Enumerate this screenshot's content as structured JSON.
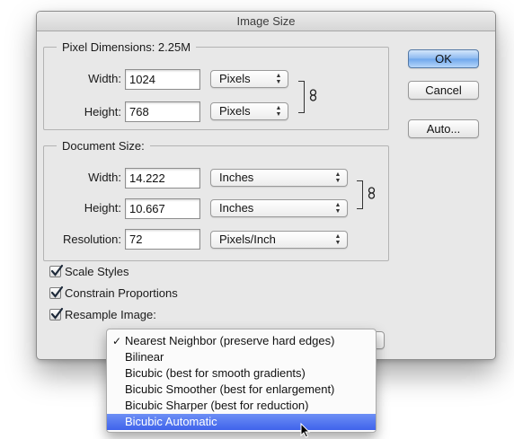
{
  "window": {
    "title": "Image Size"
  },
  "pixel_dimensions": {
    "legend": "Pixel Dimensions:  2.25M",
    "width_label": "Width:",
    "width_value": "1024",
    "width_unit": "Pixels",
    "height_label": "Height:",
    "height_value": "768",
    "height_unit": "Pixels"
  },
  "document_size": {
    "legend": "Document Size:",
    "width_label": "Width:",
    "width_value": "14.222",
    "width_unit": "Inches",
    "height_label": "Height:",
    "height_value": "10.667",
    "height_unit": "Inches",
    "resolution_label": "Resolution:",
    "resolution_value": "72",
    "resolution_unit": "Pixels/Inch"
  },
  "buttons": {
    "ok": "OK",
    "cancel": "Cancel",
    "auto": "Auto..."
  },
  "options": {
    "scale_styles": {
      "label": "Scale Styles",
      "checked": true
    },
    "constrain_proportions": {
      "label": "Constrain Proportions",
      "checked": true
    },
    "resample_image": {
      "label": "Resample Image:",
      "checked": true
    }
  },
  "resample_menu": {
    "items": [
      {
        "label": "Nearest Neighbor (preserve hard edges)",
        "checked": true
      },
      {
        "label": "Bilinear"
      },
      {
        "label": "Bicubic (best for smooth gradients)"
      },
      {
        "label": "Bicubic Smoother (best for enlargement)"
      },
      {
        "label": "Bicubic Sharper (best for reduction)"
      },
      {
        "label": "Bicubic Automatic",
        "highlighted": true
      }
    ],
    "checkmark": "✓",
    "highlight_color": "#4a6cf0"
  },
  "icons": {
    "link": "chain-link-icon",
    "stepper": "up-down-arrows-icon",
    "checkbox": "checkmark-icon",
    "cursor": "mouse-pointer-icon"
  },
  "colors": {
    "default_button": "#7fb3f2",
    "dialog_bg": "#e8e8e8"
  }
}
